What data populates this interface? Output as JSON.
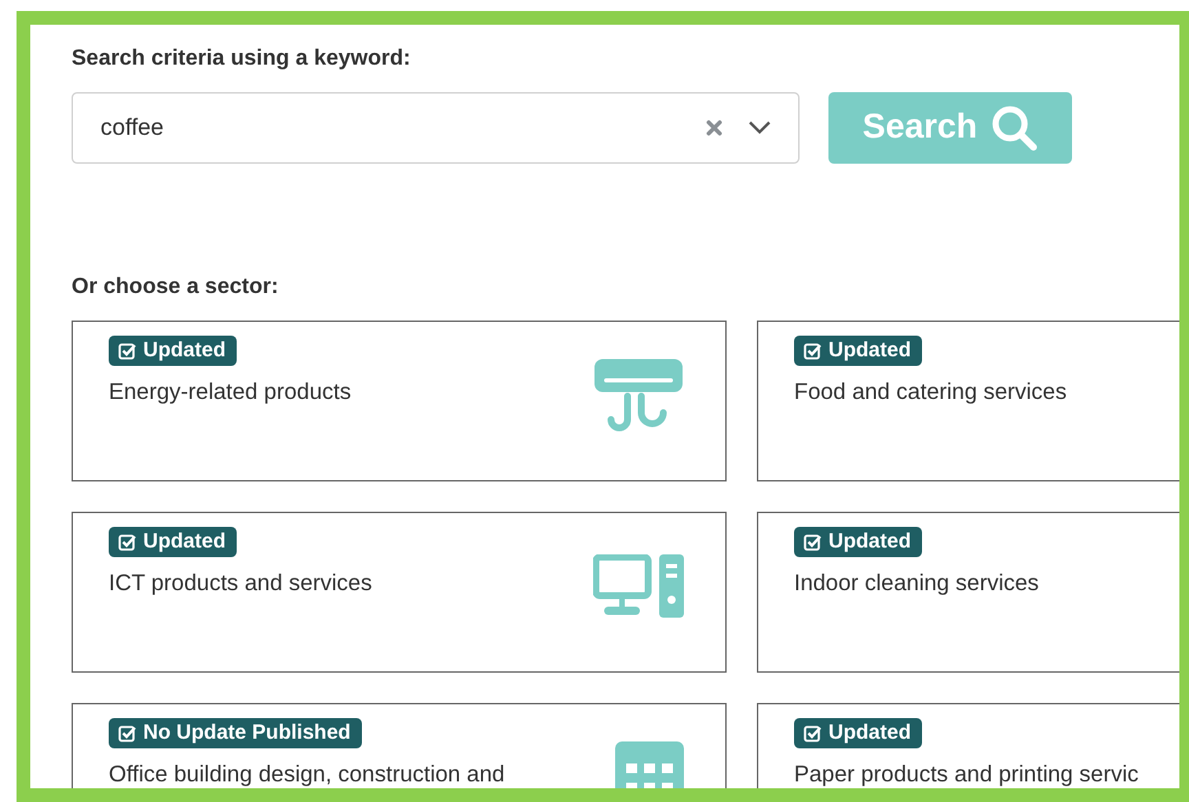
{
  "search": {
    "label": "Search criteria using a keyword:",
    "value": "coffee",
    "button": "Search"
  },
  "sectors_heading": "Or choose a sector:",
  "sectors": [
    {
      "status": "Updated",
      "name": "Energy-related products"
    },
    {
      "status": "Updated",
      "name": "Food and catering services"
    },
    {
      "status": "Updated",
      "name": "ICT products and services"
    },
    {
      "status": "Updated",
      "name": "Indoor cleaning services"
    },
    {
      "status": "No Update Published",
      "name": "Office building design, construction and"
    },
    {
      "status": "Updated",
      "name": "Paper products and printing servic"
    }
  ]
}
